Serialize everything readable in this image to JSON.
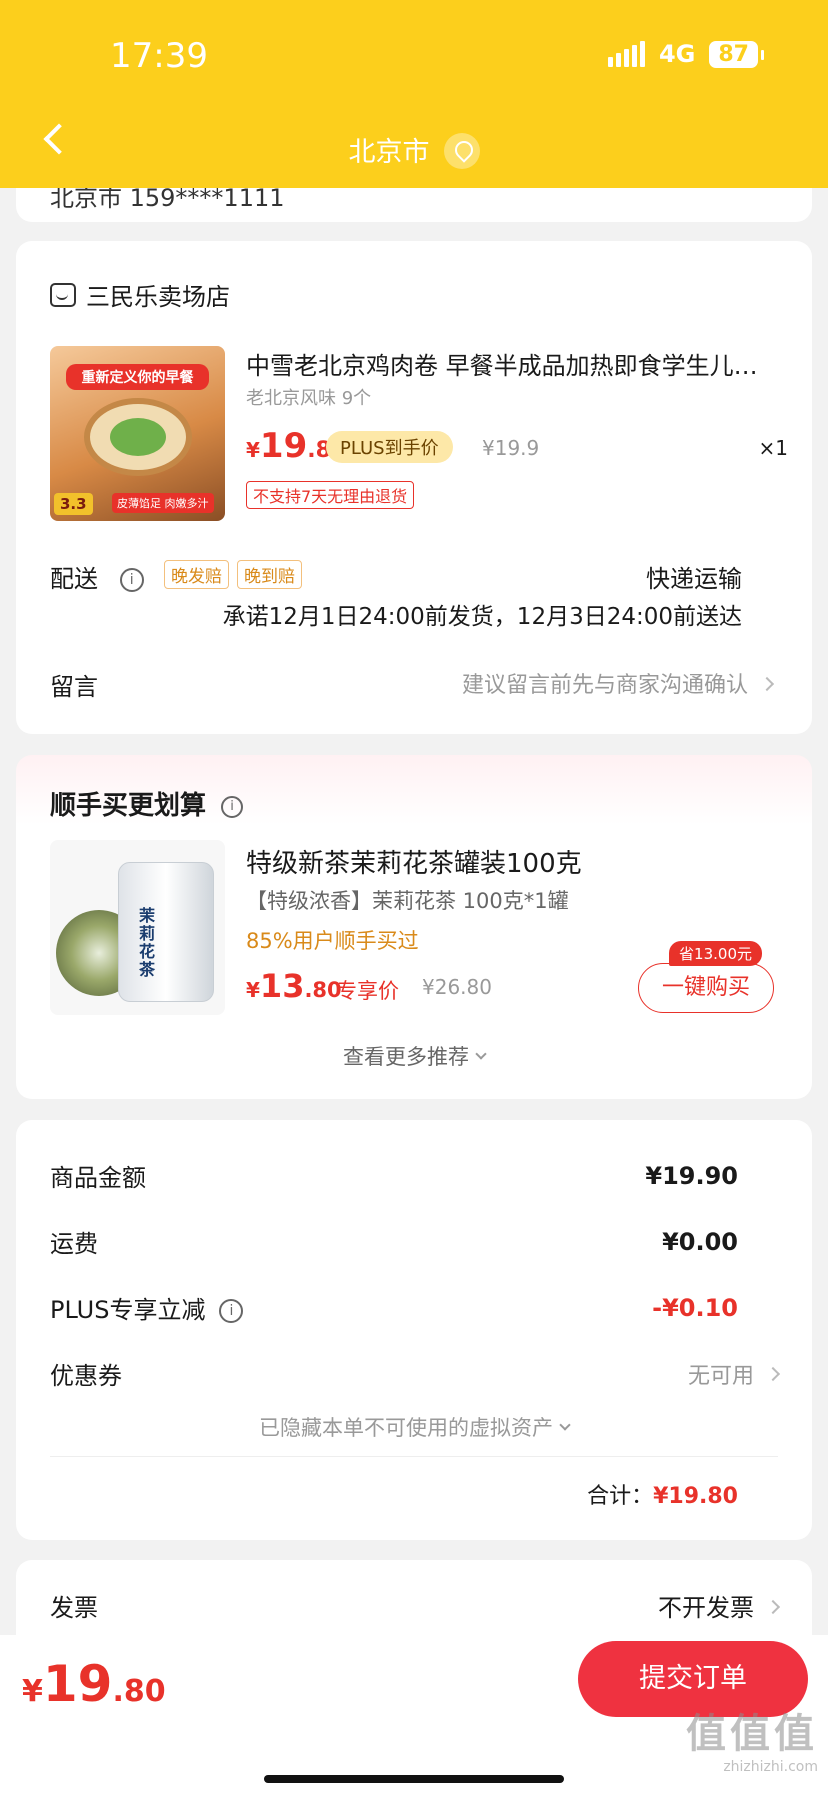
{
  "status_bar": {
    "time": "17:39",
    "network": "4G",
    "battery": "87"
  },
  "nav": {
    "title": "北京市"
  },
  "address": {
    "partial": "北京市  159****1111"
  },
  "store": {
    "name": "三民乐卖场店",
    "product": {
      "image_banner": "重新定义你的早餐",
      "image_price": "3.3",
      "image_foot": "皮薄馅足 肉嫩多汁",
      "title": "中雪老北京鸡肉卷 早餐半成品加热即食学生儿…",
      "spec": "老北京风味 9个",
      "price_symbol": "¥",
      "price_int": "19",
      "price_dec": ".8",
      "plus_label": "PLUS到手价",
      "original_price": "¥19.9",
      "quantity": "×1",
      "return_notice": "不支持7天无理由退货"
    },
    "delivery": {
      "label": "配送",
      "tags": [
        "晚发赔",
        "晚到赔"
      ],
      "type": "快递运输",
      "promise": "承诺12月1日24:00前发货，12月3日24:00前送达"
    },
    "message": {
      "label": "留言",
      "hint": "建议留言前先与商家沟通确认"
    }
  },
  "recommend": {
    "title": "顺手买更划算",
    "item": {
      "image_label": "茉莉花茶",
      "title": "特级新茶茉莉花茶罐装100克",
      "spec": "【特级浓香】茉莉花茶 100克*1罐",
      "bought": "85%用户顺手买过",
      "price_symbol": "¥",
      "price_int": "13",
      "price_dec": ".80",
      "exclusive": "专享价",
      "original_price": "¥26.80",
      "save_badge": "省13.00元",
      "buy_button": "一键购买"
    },
    "more": "查看更多推荐"
  },
  "summary": {
    "goods_label": "商品金额",
    "goods_value": "¥19.90",
    "shipping_label": "运费",
    "shipping_value": "¥0.00",
    "plus_label": "PLUS专享立减",
    "plus_value": "-¥0.10",
    "coupon_label": "优惠券",
    "coupon_value": "无可用",
    "hidden_assets": "已隐藏本单不可使用的虚拟资产",
    "total_label": "合计：",
    "total_value": "¥19.80"
  },
  "invoice": {
    "label": "发票",
    "value": "不开发票"
  },
  "bottom": {
    "price_symbol": "¥",
    "price_int": "19",
    "price_dec": ".80",
    "submit": "提交订单",
    "watermark": "值值值",
    "watermark_url": "zhizhizhi.com"
  },
  "colors": {
    "header": "#fccf1c",
    "accent_red": "#e8322a",
    "plus_badge": "#fde8a8"
  }
}
